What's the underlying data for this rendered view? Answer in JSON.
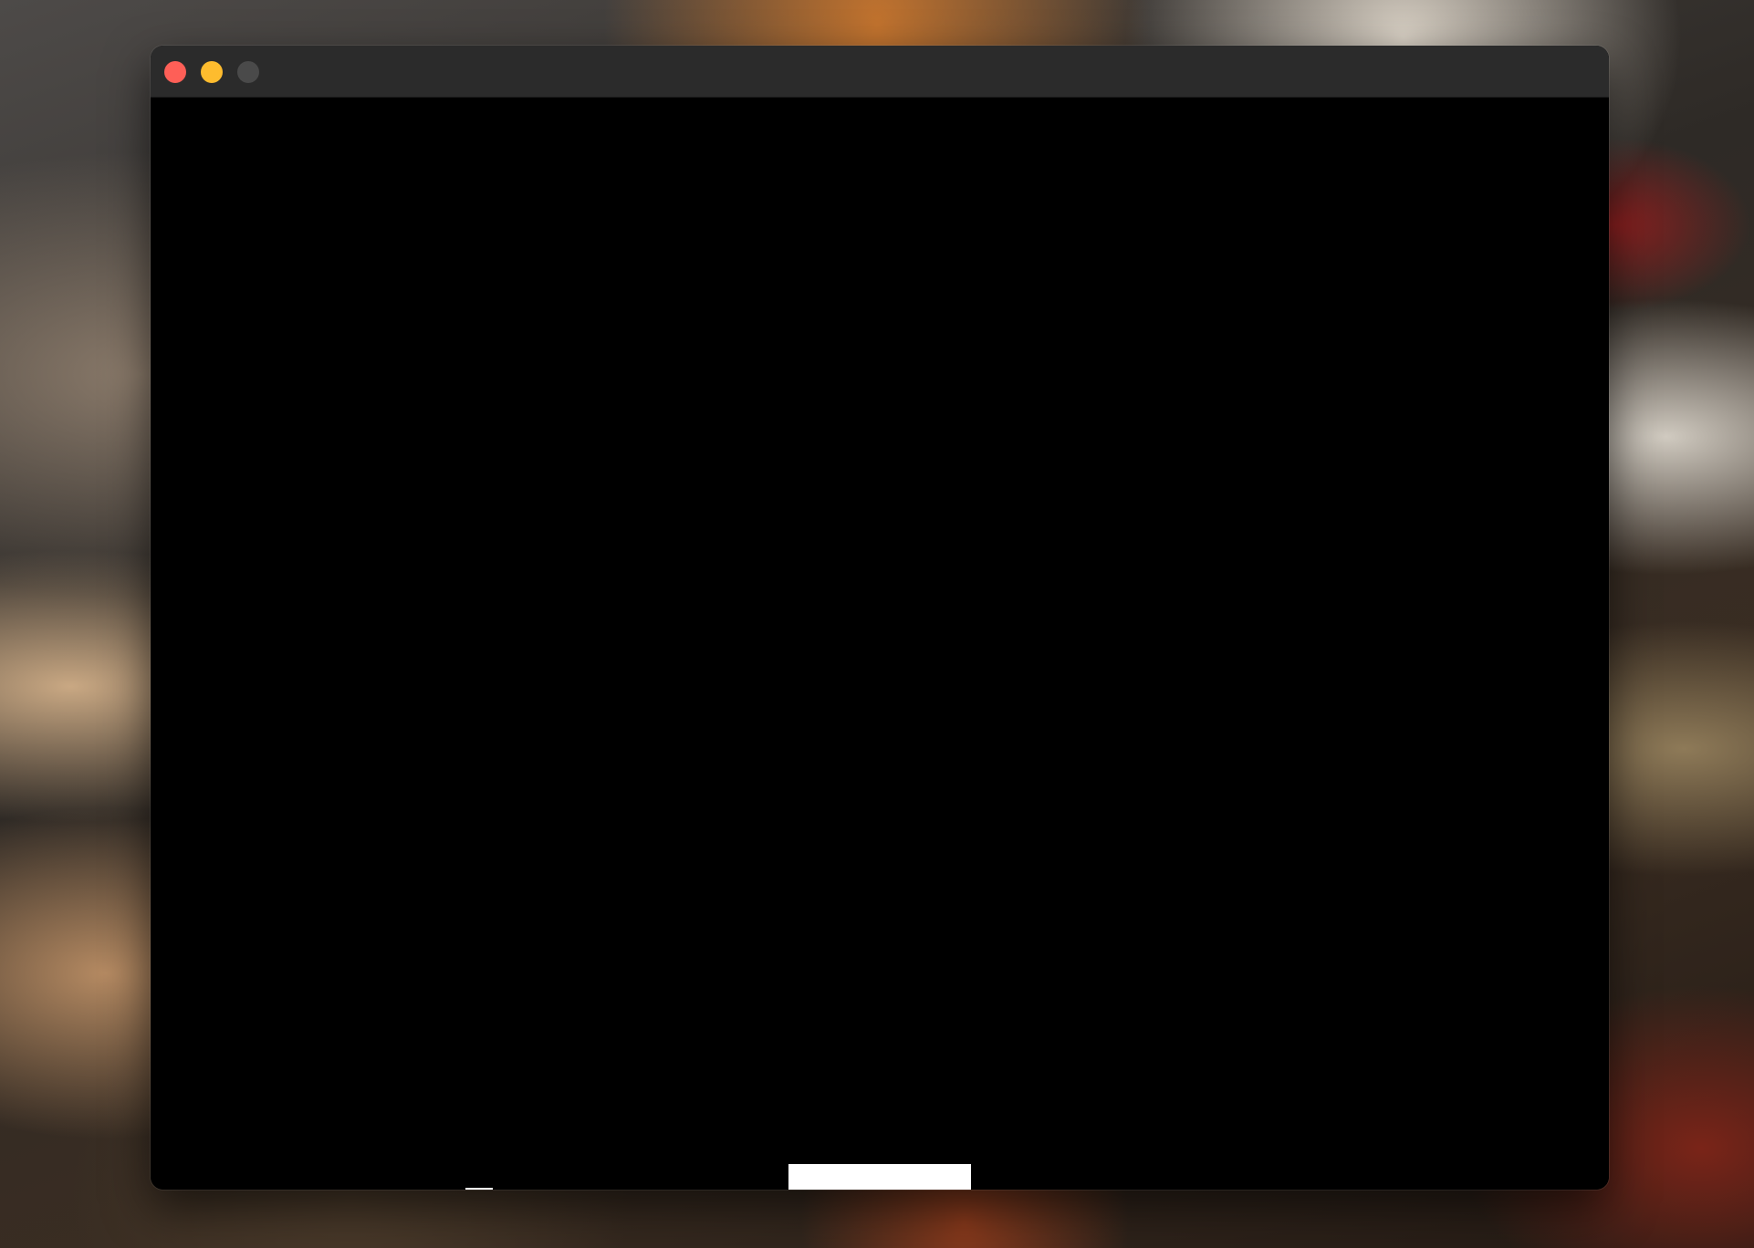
{
  "window": {
    "controls": [
      "close",
      "minimize",
      "zoom"
    ],
    "colors": {
      "close": "#fe5f57",
      "minimize": "#febc2e",
      "zoom_disabled": "#4a4a4a",
      "titlebar": "#2b2b2b",
      "canvas": "#000000"
    }
  },
  "game": {
    "objects": [
      "paddle",
      "ball"
    ],
    "object_color": "#ffffff"
  }
}
